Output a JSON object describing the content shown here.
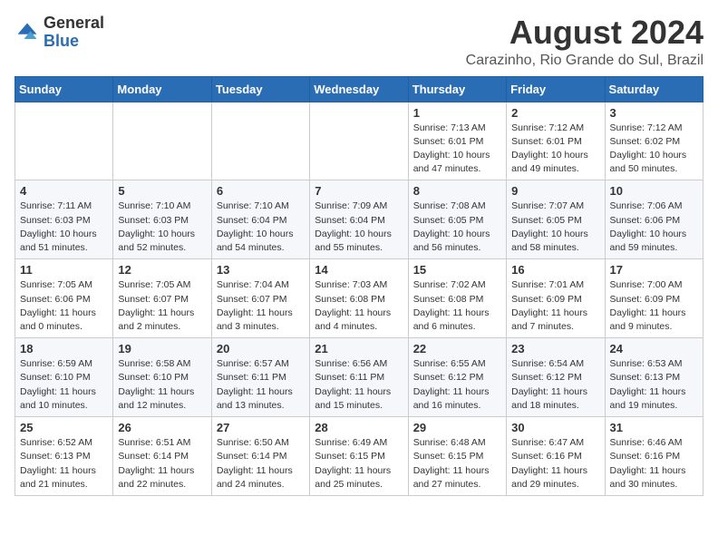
{
  "header": {
    "logo_line1": "General",
    "logo_line2": "Blue",
    "month": "August 2024",
    "location": "Carazinho, Rio Grande do Sul, Brazil"
  },
  "weekdays": [
    "Sunday",
    "Monday",
    "Tuesday",
    "Wednesday",
    "Thursday",
    "Friday",
    "Saturday"
  ],
  "weeks": [
    [
      {
        "day": "",
        "info": ""
      },
      {
        "day": "",
        "info": ""
      },
      {
        "day": "",
        "info": ""
      },
      {
        "day": "",
        "info": ""
      },
      {
        "day": "1",
        "info": "Sunrise: 7:13 AM\nSunset: 6:01 PM\nDaylight: 10 hours\nand 47 minutes."
      },
      {
        "day": "2",
        "info": "Sunrise: 7:12 AM\nSunset: 6:01 PM\nDaylight: 10 hours\nand 49 minutes."
      },
      {
        "day": "3",
        "info": "Sunrise: 7:12 AM\nSunset: 6:02 PM\nDaylight: 10 hours\nand 50 minutes."
      }
    ],
    [
      {
        "day": "4",
        "info": "Sunrise: 7:11 AM\nSunset: 6:03 PM\nDaylight: 10 hours\nand 51 minutes."
      },
      {
        "day": "5",
        "info": "Sunrise: 7:10 AM\nSunset: 6:03 PM\nDaylight: 10 hours\nand 52 minutes."
      },
      {
        "day": "6",
        "info": "Sunrise: 7:10 AM\nSunset: 6:04 PM\nDaylight: 10 hours\nand 54 minutes."
      },
      {
        "day": "7",
        "info": "Sunrise: 7:09 AM\nSunset: 6:04 PM\nDaylight: 10 hours\nand 55 minutes."
      },
      {
        "day": "8",
        "info": "Sunrise: 7:08 AM\nSunset: 6:05 PM\nDaylight: 10 hours\nand 56 minutes."
      },
      {
        "day": "9",
        "info": "Sunrise: 7:07 AM\nSunset: 6:05 PM\nDaylight: 10 hours\nand 58 minutes."
      },
      {
        "day": "10",
        "info": "Sunrise: 7:06 AM\nSunset: 6:06 PM\nDaylight: 10 hours\nand 59 minutes."
      }
    ],
    [
      {
        "day": "11",
        "info": "Sunrise: 7:05 AM\nSunset: 6:06 PM\nDaylight: 11 hours\nand 0 minutes."
      },
      {
        "day": "12",
        "info": "Sunrise: 7:05 AM\nSunset: 6:07 PM\nDaylight: 11 hours\nand 2 minutes."
      },
      {
        "day": "13",
        "info": "Sunrise: 7:04 AM\nSunset: 6:07 PM\nDaylight: 11 hours\nand 3 minutes."
      },
      {
        "day": "14",
        "info": "Sunrise: 7:03 AM\nSunset: 6:08 PM\nDaylight: 11 hours\nand 4 minutes."
      },
      {
        "day": "15",
        "info": "Sunrise: 7:02 AM\nSunset: 6:08 PM\nDaylight: 11 hours\nand 6 minutes."
      },
      {
        "day": "16",
        "info": "Sunrise: 7:01 AM\nSunset: 6:09 PM\nDaylight: 11 hours\nand 7 minutes."
      },
      {
        "day": "17",
        "info": "Sunrise: 7:00 AM\nSunset: 6:09 PM\nDaylight: 11 hours\nand 9 minutes."
      }
    ],
    [
      {
        "day": "18",
        "info": "Sunrise: 6:59 AM\nSunset: 6:10 PM\nDaylight: 11 hours\nand 10 minutes."
      },
      {
        "day": "19",
        "info": "Sunrise: 6:58 AM\nSunset: 6:10 PM\nDaylight: 11 hours\nand 12 minutes."
      },
      {
        "day": "20",
        "info": "Sunrise: 6:57 AM\nSunset: 6:11 PM\nDaylight: 11 hours\nand 13 minutes."
      },
      {
        "day": "21",
        "info": "Sunrise: 6:56 AM\nSunset: 6:11 PM\nDaylight: 11 hours\nand 15 minutes."
      },
      {
        "day": "22",
        "info": "Sunrise: 6:55 AM\nSunset: 6:12 PM\nDaylight: 11 hours\nand 16 minutes."
      },
      {
        "day": "23",
        "info": "Sunrise: 6:54 AM\nSunset: 6:12 PM\nDaylight: 11 hours\nand 18 minutes."
      },
      {
        "day": "24",
        "info": "Sunrise: 6:53 AM\nSunset: 6:13 PM\nDaylight: 11 hours\nand 19 minutes."
      }
    ],
    [
      {
        "day": "25",
        "info": "Sunrise: 6:52 AM\nSunset: 6:13 PM\nDaylight: 11 hours\nand 21 minutes."
      },
      {
        "day": "26",
        "info": "Sunrise: 6:51 AM\nSunset: 6:14 PM\nDaylight: 11 hours\nand 22 minutes."
      },
      {
        "day": "27",
        "info": "Sunrise: 6:50 AM\nSunset: 6:14 PM\nDaylight: 11 hours\nand 24 minutes."
      },
      {
        "day": "28",
        "info": "Sunrise: 6:49 AM\nSunset: 6:15 PM\nDaylight: 11 hours\nand 25 minutes."
      },
      {
        "day": "29",
        "info": "Sunrise: 6:48 AM\nSunset: 6:15 PM\nDaylight: 11 hours\nand 27 minutes."
      },
      {
        "day": "30",
        "info": "Sunrise: 6:47 AM\nSunset: 6:16 PM\nDaylight: 11 hours\nand 29 minutes."
      },
      {
        "day": "31",
        "info": "Sunrise: 6:46 AM\nSunset: 6:16 PM\nDaylight: 11 hours\nand 30 minutes."
      }
    ]
  ]
}
